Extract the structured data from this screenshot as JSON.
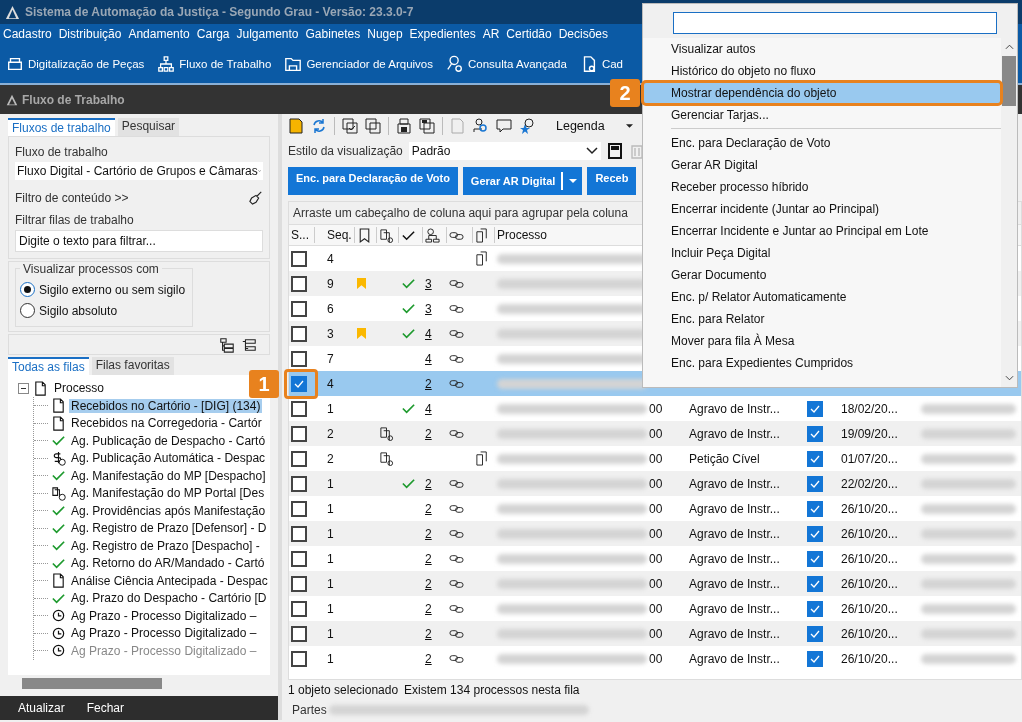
{
  "window": {
    "title": "Sistema de Automação da Justiça - Segundo Grau - Versão: 23.3.0-7"
  },
  "menu_bar": [
    "Cadastro",
    "Distribuição",
    "Andamento",
    "Carga",
    "Julgamento",
    "Gabinetes",
    "Nugep",
    "Expedientes",
    "AR",
    "Certidão",
    "Decisões"
  ],
  "toolbar": [
    {
      "label": "Digitalização de Peças",
      "kind": "scanner"
    },
    {
      "label": "Fluxo de Trabalho",
      "kind": "hierarchy"
    },
    {
      "label": "Gerenciador de Arquivos",
      "kind": "folder"
    },
    {
      "label": "Consulta Avançada",
      "kind": "search-gear"
    },
    {
      "label": "Cad",
      "kind": "doc-gear"
    }
  ],
  "panel_title": "Fluxo de Trabalho",
  "left_panel": {
    "tabs": [
      {
        "label": "Fluxos de trabalho",
        "selected": true
      },
      {
        "label": "Pesquisar",
        "selected": false
      }
    ],
    "workflow_label": "Fluxo de trabalho",
    "workflow_value": "Fluxo Digital - Cartório de Grupos e Câmaras",
    "content_filter": "Filtro de conteúdo >>",
    "filter_label": "Filtrar filas de trabalho",
    "filter_placeholder": "Digite o texto para filtrar...",
    "visibility": {
      "legend": "Visualizar processos com",
      "options": [
        {
          "label": "Sigilo externo ou sem sigilo",
          "selected": true
        },
        {
          "label": "Sigilo absoluto",
          "selected": false
        }
      ]
    },
    "queue_tabs": [
      {
        "label": "Todas as filas",
        "selected": true
      },
      {
        "label": "Filas favoritas",
        "selected": false
      }
    ],
    "tree": {
      "label": "Processo",
      "expanded": true,
      "children": [
        {
          "label": "Recebidos no Cartório - [DIG] (134)",
          "kind": "doc",
          "selected": true,
          "disabled": false
        },
        {
          "label": "Recebidos na Corregedoria - Cartór",
          "kind": "doc",
          "selected": false,
          "disabled": false
        },
        {
          "label": "Ag. Publicação de Despacho - Cartó",
          "kind": "check",
          "selected": false,
          "disabled": false
        },
        {
          "label": "Ag. Publicação Automática - Despac",
          "kind": "dollar-clock",
          "selected": false,
          "disabled": false
        },
        {
          "label": "Ag. Manifestação do MP [Despacho]",
          "kind": "check",
          "selected": false,
          "disabled": false
        },
        {
          "label": "Ag. Manifestação do MP Portal [Des",
          "kind": "clip-clock",
          "selected": false,
          "disabled": false
        },
        {
          "label": "Ag. Providências após Manifestação",
          "kind": "check",
          "selected": false,
          "disabled": false
        },
        {
          "label": "Ag. Registro de Prazo [Defensor] - D",
          "kind": "check",
          "selected": false,
          "disabled": false
        },
        {
          "label": "Ag. Registro de Prazo [Despacho] -",
          "kind": "check",
          "selected": false,
          "disabled": false
        },
        {
          "label": "Ag. Retorno do AR/Mandado - Cartó",
          "kind": "check",
          "selected": false,
          "disabled": false
        },
        {
          "label": "Análise Ciência Antecipada - Despac",
          "kind": "doc",
          "selected": false,
          "disabled": false
        },
        {
          "label": "Ag. Prazo do Despacho - Cartório [D",
          "kind": "check",
          "selected": false,
          "disabled": false
        },
        {
          "label": "Ag Prazo - Processo Digitalizado –",
          "kind": "clock",
          "selected": false,
          "disabled": false
        },
        {
          "label": "Ag Prazo - Processo Digitalizado –",
          "kind": "clock",
          "selected": false,
          "disabled": false
        },
        {
          "label": "Ag Prazo - Processo Digitalizado –",
          "kind": "clock",
          "selected": false,
          "disabled": true
        }
      ]
    },
    "footer_buttons": [
      "Atualizar",
      "Fechar"
    ]
  },
  "grid_toolbar": {
    "legend": "Legenda"
  },
  "view_style": {
    "label": "Estilo da visualização",
    "value": "Padrão"
  },
  "action_buttons": [
    {
      "label": "Enc. para Declaração de Voto",
      "dropdown": false
    },
    {
      "label": "Gerar AR Digital",
      "dropdown": true
    },
    {
      "label": "Receb",
      "dropdown": false
    }
  ],
  "group_hint": "Arraste um cabeçalho de coluna aqui para agrupar pela coluna",
  "columns": [
    {
      "kind": "text",
      "label": "S..."
    },
    {
      "kind": "sort",
      "label": "Seq."
    },
    {
      "kind": "bookmark"
    },
    {
      "kind": "clip"
    },
    {
      "kind": "check"
    },
    {
      "kind": "hierarchy"
    },
    {
      "kind": "link"
    },
    {
      "kind": "doc"
    },
    {
      "kind": "text",
      "label": "Processo"
    }
  ],
  "rows": [
    {
      "checked": false,
      "selected": false,
      "seq": "4",
      "bookmark": false,
      "clip": false,
      "done": false,
      "link": false,
      "doc": true
    },
    {
      "checked": false,
      "selected": false,
      "seq": "9",
      "bookmark": true,
      "clip": false,
      "done": true,
      "count": "3",
      "link": true,
      "doc": false
    },
    {
      "checked": false,
      "selected": false,
      "seq": "6",
      "bookmark": false,
      "clip": false,
      "done": true,
      "count": "3",
      "link": true,
      "doc": false
    },
    {
      "checked": false,
      "selected": false,
      "seq": "3",
      "bookmark": true,
      "clip": false,
      "done": true,
      "count": "4",
      "link": true,
      "doc": false
    },
    {
      "checked": false,
      "selected": false,
      "seq": "7",
      "bookmark": false,
      "clip": false,
      "done": false,
      "count": "4",
      "link": true,
      "doc": false
    },
    {
      "checked": true,
      "selected": true,
      "seq": "4",
      "bookmark": false,
      "clip": false,
      "done": false,
      "count": "2",
      "link": true,
      "doc": false
    },
    {
      "checked": false,
      "selected": false,
      "seq": "1",
      "bookmark": false,
      "clip": false,
      "done": true,
      "count": "4",
      "link": false,
      "doc": false,
      "process_tail": "00",
      "classe": "Agravo de Instr...",
      "flag": true,
      "date": "18/02/20..."
    },
    {
      "checked": false,
      "selected": false,
      "seq": "2",
      "bookmark": false,
      "clip": true,
      "done": false,
      "count": "2",
      "link": true,
      "doc": false,
      "process_tail": "00",
      "classe": "Agravo de Instr...",
      "flag": true,
      "date": "19/09/20..."
    },
    {
      "checked": false,
      "selected": false,
      "seq": "2",
      "bookmark": false,
      "clip": true,
      "done": false,
      "link": false,
      "doc": true,
      "process_tail": "00",
      "classe": "Petição Cível",
      "flag": true,
      "date": "01/07/20..."
    },
    {
      "checked": false,
      "selected": false,
      "seq": "1",
      "bookmark": false,
      "clip": false,
      "done": true,
      "count": "2",
      "link": true,
      "doc": false,
      "process_tail": "00",
      "classe": "Agravo de Instr...",
      "flag": true,
      "date": "22/02/20..."
    },
    {
      "checked": false,
      "selected": false,
      "seq": "1",
      "bookmark": false,
      "clip": false,
      "done": false,
      "count": "2",
      "link": true,
      "doc": false,
      "process_tail": "00",
      "classe": "Agravo de Instr...",
      "flag": true,
      "date": "26/10/20..."
    },
    {
      "checked": false,
      "selected": false,
      "seq": "1",
      "bookmark": false,
      "clip": false,
      "done": false,
      "count": "2",
      "link": true,
      "doc": false,
      "process_tail": "00",
      "classe": "Agravo de Instr...",
      "flag": true,
      "date": "26/10/20..."
    },
    {
      "checked": false,
      "selected": false,
      "seq": "1",
      "bookmark": false,
      "clip": false,
      "done": false,
      "count": "2",
      "link": true,
      "doc": false,
      "process_tail": "00",
      "classe": "Agravo de Instr...",
      "flag": true,
      "date": "26/10/20..."
    },
    {
      "checked": false,
      "selected": false,
      "seq": "1",
      "bookmark": false,
      "clip": false,
      "done": false,
      "count": "2",
      "link": true,
      "doc": false,
      "process_tail": "00",
      "classe": "Agravo de Instr...",
      "flag": true,
      "date": "26/10/20..."
    },
    {
      "checked": false,
      "selected": false,
      "seq": "1",
      "bookmark": false,
      "clip": false,
      "done": false,
      "count": "2",
      "link": true,
      "doc": false,
      "process_tail": "00",
      "classe": "Agravo de Instr...",
      "flag": true,
      "date": "26/10/20..."
    },
    {
      "checked": false,
      "selected": false,
      "seq": "1",
      "bookmark": false,
      "clip": false,
      "done": false,
      "count": "2",
      "link": true,
      "doc": false,
      "process_tail": "00",
      "classe": "Agravo de Instr...",
      "flag": true,
      "date": "26/10/20..."
    },
    {
      "checked": false,
      "selected": false,
      "seq": "1",
      "bookmark": false,
      "clip": false,
      "done": false,
      "count": "2",
      "link": true,
      "doc": false,
      "process_tail": "00",
      "classe": "Agravo de Instr...",
      "flag": true,
      "date": "26/10/20..."
    }
  ],
  "status": [
    "1 objeto selecionado",
    "Existem 134 processos nesta fila"
  ],
  "details_label": "Partes",
  "context_menu": {
    "items": [
      {
        "label": "Visualizar autos",
        "selected": false,
        "separator_after": false
      },
      {
        "label": "Histórico do objeto no fluxo",
        "selected": false,
        "separator_after": false
      },
      {
        "label": "Mostrar dependência do objeto",
        "selected": true,
        "separator_after": false
      },
      {
        "label": "Gerenciar Tarjas...",
        "selected": false,
        "separator_after": true
      },
      {
        "label": "Enc. para Declaração de Voto",
        "selected": false,
        "separator_after": false
      },
      {
        "label": "Gerar AR Digital",
        "selected": false,
        "separator_after": false
      },
      {
        "label": "Receber processo híbrido",
        "selected": false,
        "separator_after": false
      },
      {
        "label": "Encerrar incidente (Juntar ao Principal)",
        "selected": false,
        "separator_after": false
      },
      {
        "label": "Encerrar Incidente e Juntar ao Principal em Lote",
        "selected": false,
        "separator_after": false
      },
      {
        "label": "Incluir Peça Digital",
        "selected": false,
        "separator_after": false
      },
      {
        "label": "Gerar Documento",
        "selected": false,
        "separator_after": false
      },
      {
        "label": "Enc. p/ Relator Automaticamente",
        "selected": false,
        "separator_after": false
      },
      {
        "label": "Enc. para Relator",
        "selected": false,
        "separator_after": false
      },
      {
        "label": "Mover para fila À Mesa",
        "selected": false,
        "separator_after": false
      },
      {
        "label": "Enc. para Expedientes Cumpridos",
        "selected": false,
        "separator_after": false
      }
    ]
  },
  "callouts": [
    "1",
    "2"
  ]
}
